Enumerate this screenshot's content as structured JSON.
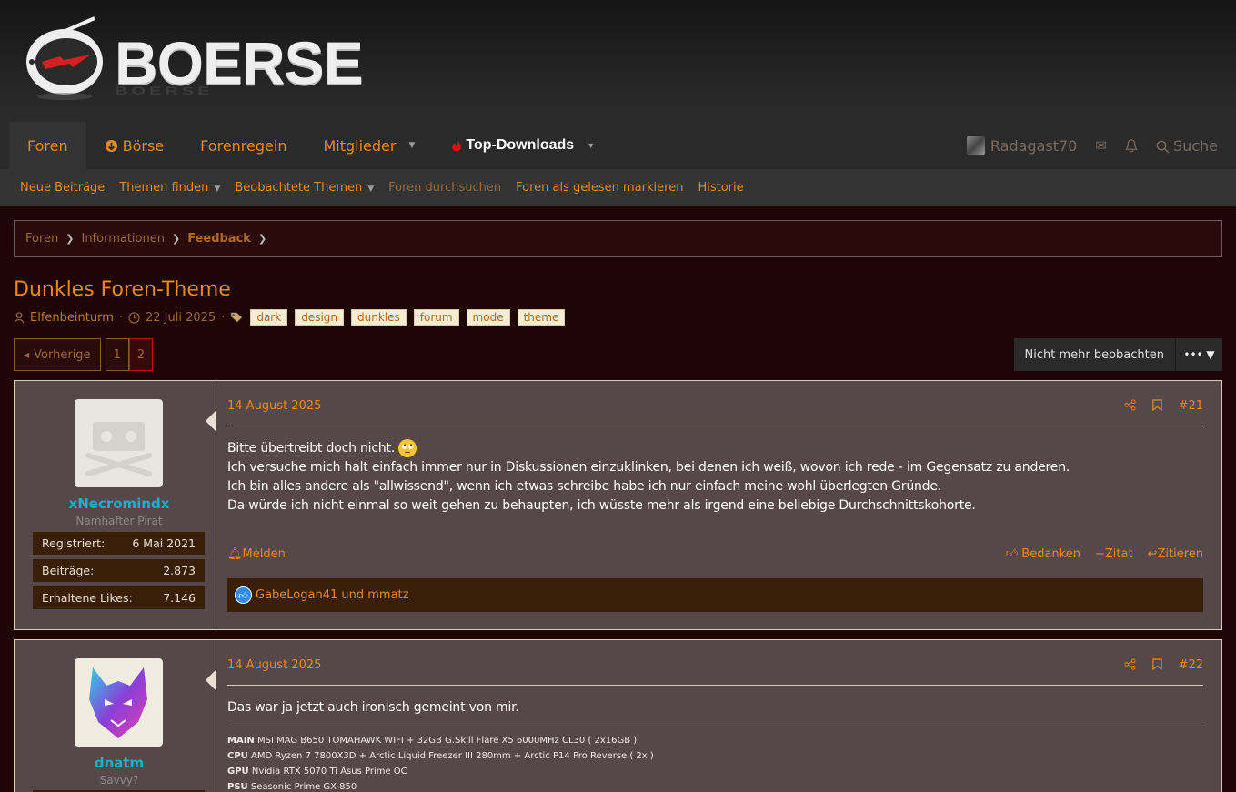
{
  "header": {
    "logo_text": "BOERSE"
  },
  "nav": {
    "tabs": [
      {
        "label": "Foren"
      },
      {
        "label": "Börse"
      },
      {
        "label": "Forenregeln"
      },
      {
        "label": "Mitglieder"
      },
      {
        "label": "Top-Downloads"
      }
    ],
    "username": "Radagast70",
    "search_label": "Suche"
  },
  "subnav": {
    "items": [
      "Neue Beiträge",
      "Themen finden",
      "Beobachtete Themen",
      "Foren durchsuchen",
      "Foren als gelesen markieren",
      "Historie"
    ]
  },
  "breadcrumb": [
    "Foren",
    "Informationen",
    "Feedback"
  ],
  "thread": {
    "title": "Dunkles Foren-Theme",
    "author": "Elfenbeinturm",
    "date": "22 Juli 2025",
    "tags": [
      "dark",
      "design",
      "dunkles",
      "forum",
      "mode",
      "theme"
    ]
  },
  "pagination": {
    "prev": "Vorherige",
    "pages": [
      "1",
      "2"
    ],
    "current": "2"
  },
  "watch_button": "Nicht mehr beobachten",
  "posts": [
    {
      "username": "xNecromindx",
      "user_title": "Namhafter Pirat",
      "stats": [
        {
          "label": "Registriert:",
          "value": "6 Mai 2021"
        },
        {
          "label": "Beiträge:",
          "value": "2.873"
        },
        {
          "label": "Erhaltene Likes:",
          "value": "7.146"
        }
      ],
      "date": "14 August 2025",
      "number": "#21",
      "lines": [
        "Bitte übertreibt doch nicht.",
        "Ich versuche mich halt einfach immer nur in Diskussionen einzuklinken, bei denen ich weiß, wovon ich rede - im Gegensatz zu anderen.",
        "Ich bin alles andere als \"allwissend\", wenn ich etwas schreibe habe ich nur einfach meine wohl überlegten Gründe.",
        "Da würde ich nicht einmal so weit gehen zu behaupten, ich wüsste mehr als irgend eine beliebige Durchschnittskohorte."
      ],
      "report": "Melden",
      "thank": "Bedanken",
      "quote": "Zitat",
      "reply": "Zitieren",
      "likes": "GabeLogan41 und mmatz"
    },
    {
      "username": "dnatm",
      "user_title": "Savvy?",
      "date": "14 August 2025",
      "number": "#22",
      "text": "Das war ja jetzt auch ironisch gemeint von mir.",
      "signature": [
        {
          "k": "MAIN",
          "v": "MSI MAG B650 TOMAHAWK WIFI + 32GB G.Skill Flare X5 6000MHz CL30 ( 2x16GB )"
        },
        {
          "k": "CPU",
          "v": "AMD Ryzen 7 7800X3D + Arctic Liquid Freezer III 280mm + Arctic P14 Pro Reverse ( 2x )"
        },
        {
          "k": "GPU",
          "v": "Nvidia RTX 5070 Ti Asus Prime OC"
        },
        {
          "k": "PSU",
          "v": "Seasonic Prime GX-850"
        }
      ]
    }
  ]
}
